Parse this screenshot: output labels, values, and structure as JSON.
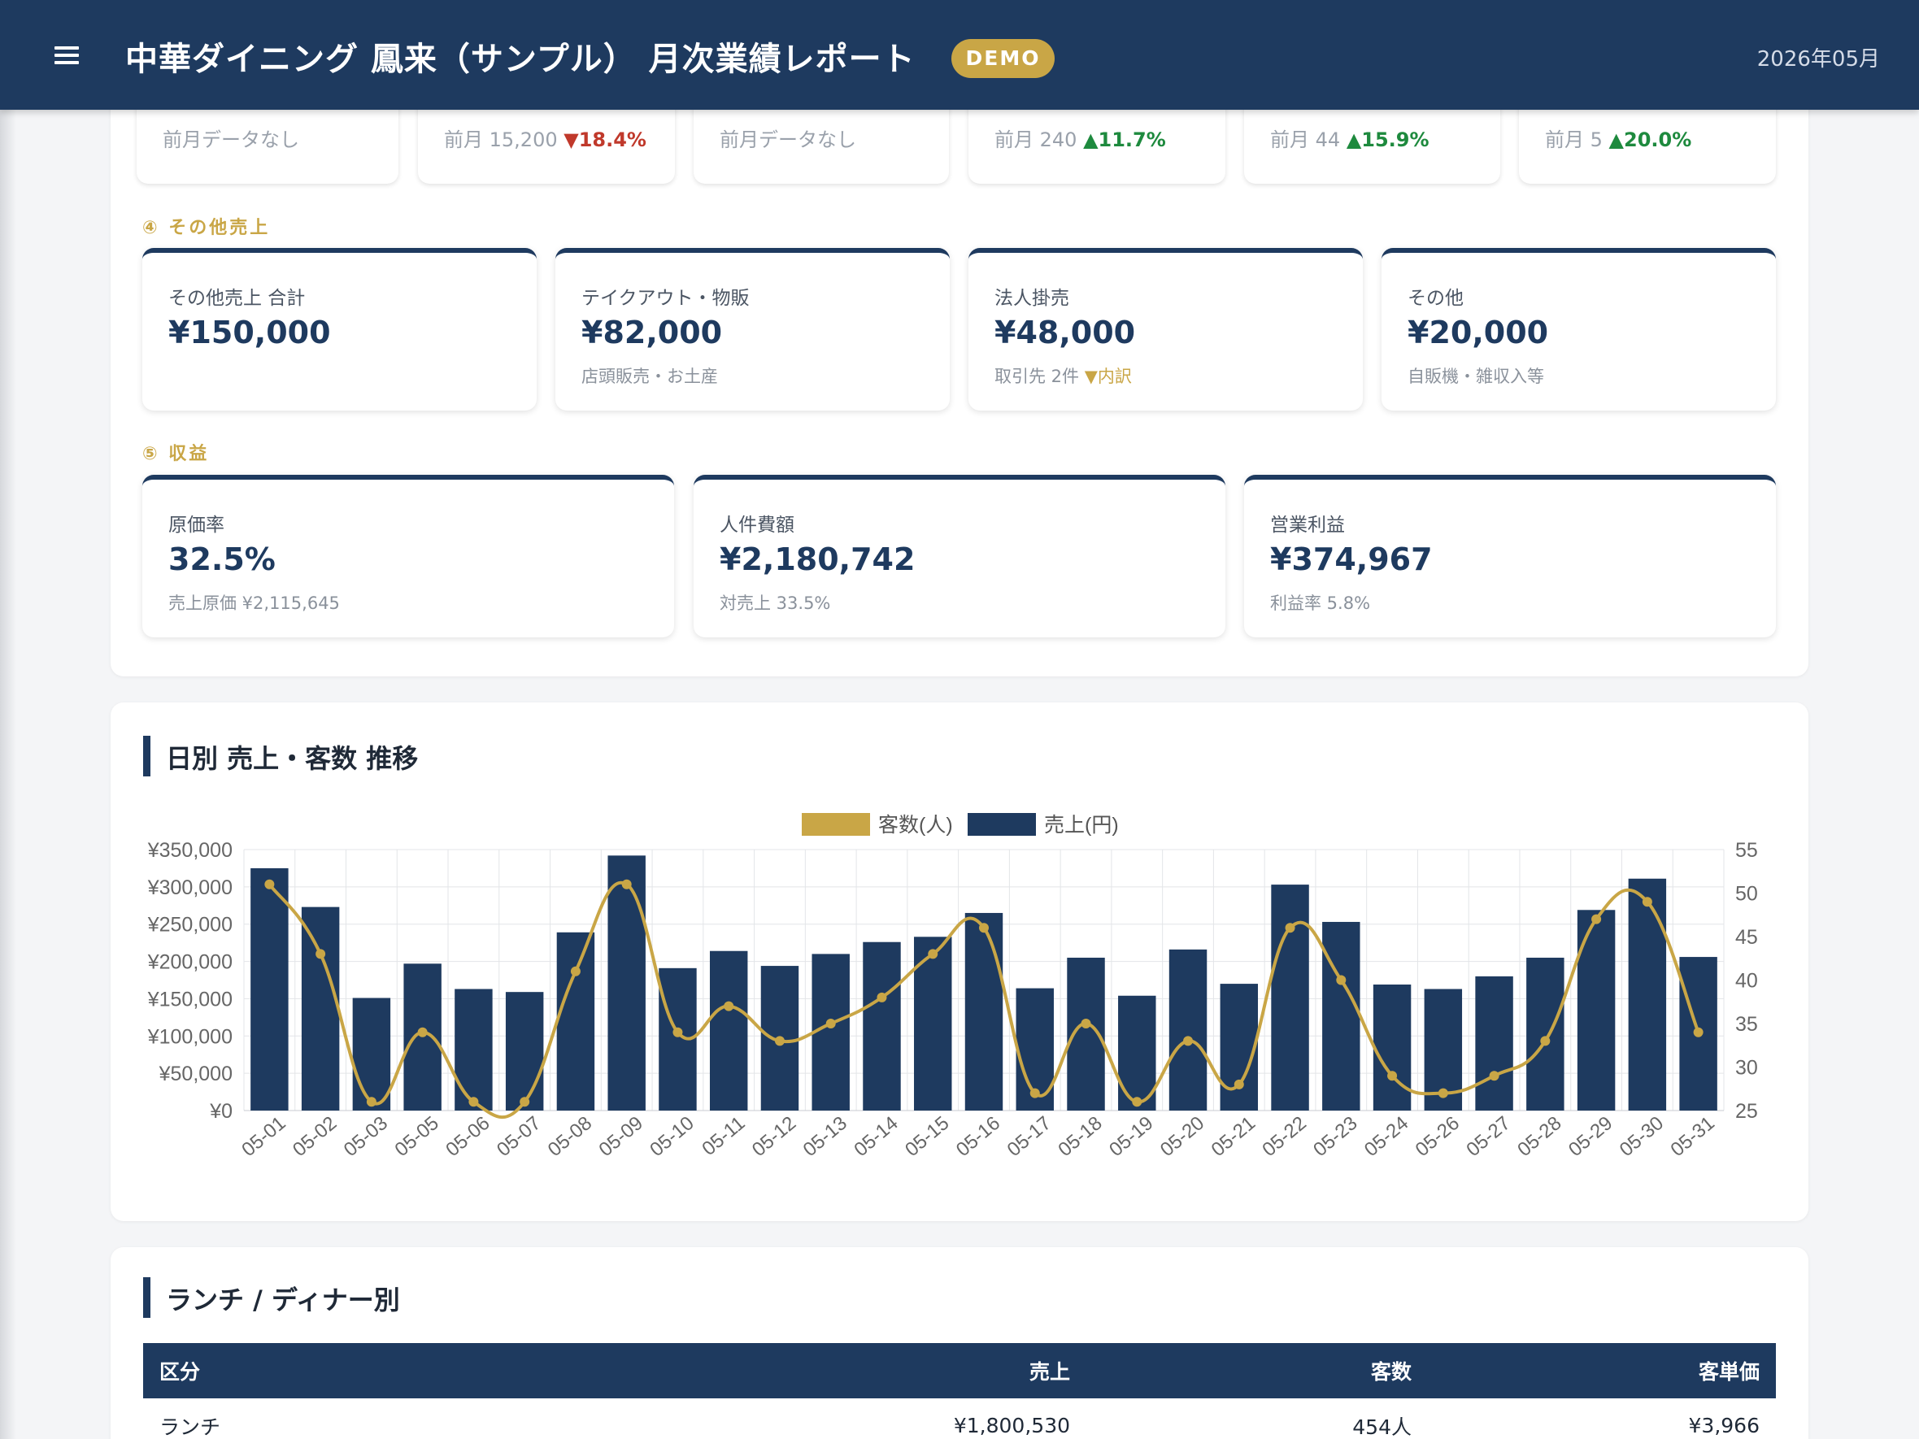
{
  "header": {
    "title": "中華ダイニング 鳳来（サンプル） 月次業績レポート",
    "badge": "DEMO",
    "period": "2026年05月"
  },
  "prev_cards": [
    {
      "text": "前月データなし",
      "delta": "",
      "direction": ""
    },
    {
      "text": "前月 15,200",
      "delta": "▼18.4%",
      "direction": "down"
    },
    {
      "text": "前月データなし",
      "delta": "",
      "direction": ""
    },
    {
      "text": "前月 240",
      "delta": "▲11.7%",
      "direction": "up"
    },
    {
      "text": "前月 44",
      "delta": "▲15.9%",
      "direction": "up"
    },
    {
      "text": "前月 5",
      "delta": "▲20.0%",
      "direction": "up"
    }
  ],
  "other_sales": {
    "label": "④ その他売上",
    "cards": [
      {
        "label": "その他売上 合計",
        "value": "¥150,000",
        "sub": "",
        "note": ""
      },
      {
        "label": "テイクアウト・物販",
        "value": "¥82,000",
        "sub": "店頭販売・お土産",
        "note": ""
      },
      {
        "label": "法人掛売",
        "value": "¥48,000",
        "sub": "取引先 2件 ",
        "note": "▼内訳"
      },
      {
        "label": "その他",
        "value": "¥20,000",
        "sub": "自販機・雑収入等",
        "note": ""
      }
    ]
  },
  "profit": {
    "label": "⑤ 収益",
    "cards": [
      {
        "label": "原価率",
        "value": "32.5%",
        "sub": "売上原価 ¥2,115,645"
      },
      {
        "label": "人件費額",
        "value": "¥2,180,742",
        "sub": "対売上 33.5%"
      },
      {
        "label": "営業利益",
        "value": "¥374,967",
        "sub": "利益率 5.8%"
      }
    ]
  },
  "chart_section": {
    "title": "日別 売上・客数 推移"
  },
  "chart_data": {
    "type": "bar",
    "categories": [
      "05-01",
      "05-02",
      "05-03",
      "05-05",
      "05-06",
      "05-07",
      "05-08",
      "05-09",
      "05-10",
      "05-11",
      "05-12",
      "05-13",
      "05-14",
      "05-15",
      "05-16",
      "05-17",
      "05-18",
      "05-19",
      "05-20",
      "05-21",
      "05-22",
      "05-23",
      "05-24",
      "05-26",
      "05-27",
      "05-28",
      "05-29",
      "05-30",
      "05-31"
    ],
    "series": [
      {
        "name": "売上(円)",
        "type": "bar",
        "axis": "left",
        "color": "#1e3a5f",
        "values": [
          325000,
          273000,
          151000,
          197000,
          163000,
          159000,
          239000,
          342000,
          191000,
          214000,
          194000,
          210000,
          226000,
          233000,
          265000,
          164000,
          205000,
          154000,
          216000,
          170000,
          303000,
          253000,
          169000,
          163000,
          180000,
          205000,
          269000,
          311000,
          206000
        ]
      },
      {
        "name": "客数(人)",
        "type": "line",
        "axis": "right",
        "color": "#c9a646",
        "values": [
          51,
          43,
          26,
          34,
          26,
          26,
          41,
          51,
          34,
          37,
          33,
          35,
          38,
          43,
          46,
          27,
          35,
          26,
          33,
          28,
          46,
          40,
          29,
          27,
          29,
          33,
          47,
          49,
          34
        ]
      }
    ],
    "y_left": {
      "min": 0,
      "max": 350000,
      "ticks": [
        "¥0",
        "¥50,000",
        "¥100,000",
        "¥150,000",
        "¥200,000",
        "¥250,000",
        "¥300,000",
        "¥350,000"
      ]
    },
    "y_right": {
      "min": 25,
      "max": 55,
      "ticks": [
        "25",
        "30",
        "35",
        "40",
        "45",
        "50",
        "55"
      ]
    },
    "legend": [
      {
        "label": "客数(人)",
        "color": "#c9a646"
      },
      {
        "label": "売上(円)",
        "color": "#1e3a5f"
      }
    ],
    "legend_position": "top-center",
    "grid": true
  },
  "table_section": {
    "title": "ランチ / ディナー別",
    "headers": [
      "区分",
      "売上",
      "客数",
      "客単価"
    ],
    "rows": [
      [
        "ランチ",
        "¥1,800,530",
        "454人",
        "¥3,966"
      ]
    ]
  }
}
